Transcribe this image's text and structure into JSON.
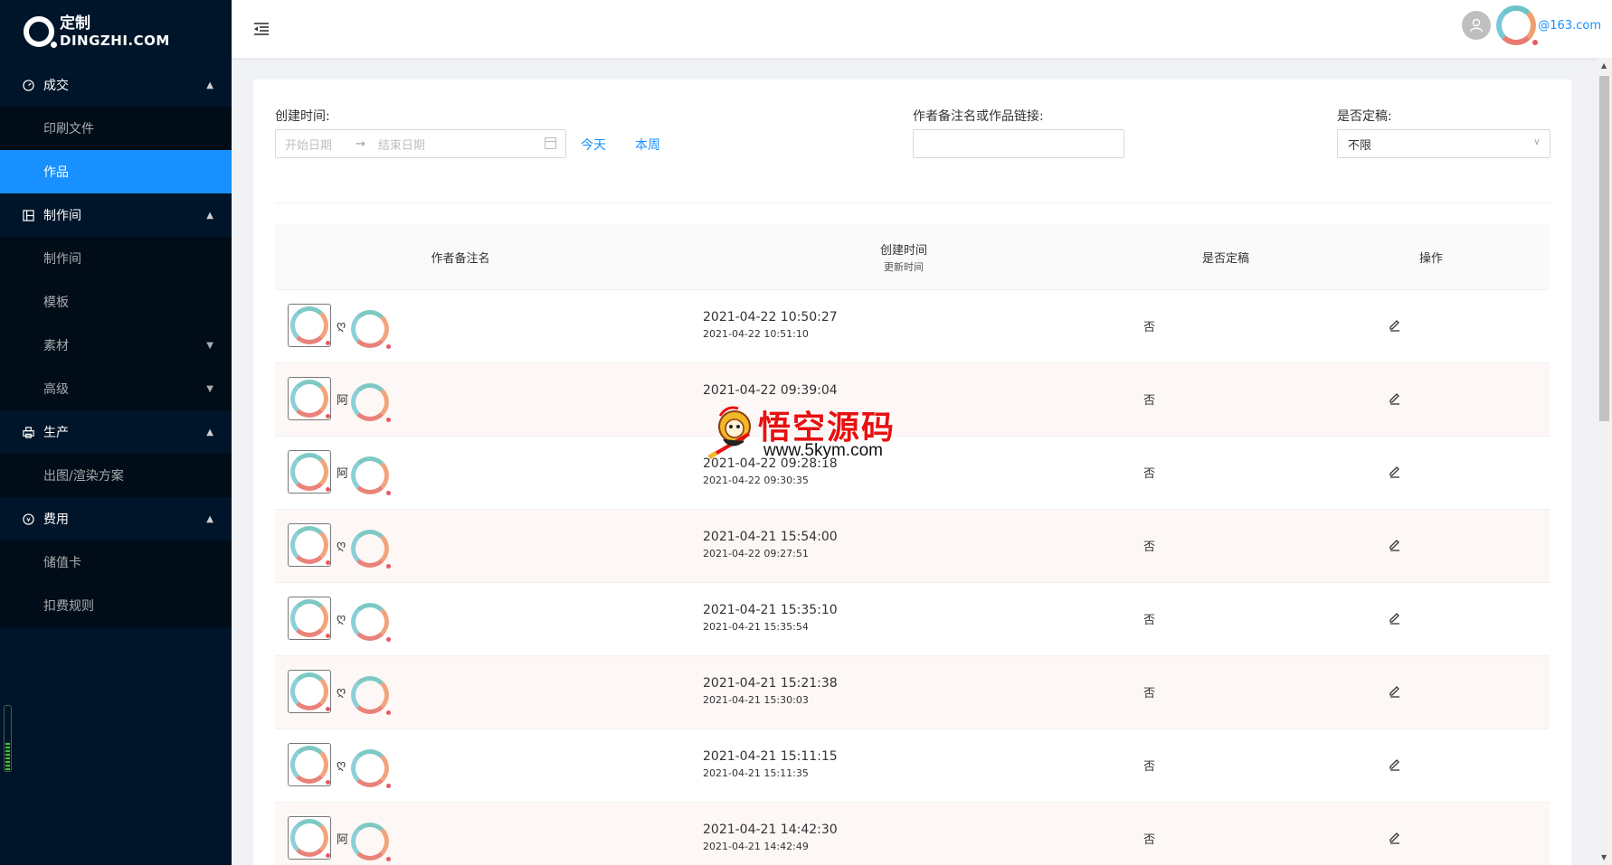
{
  "app": {
    "logo_top": "定制",
    "logo_bottom": "DINGZHI.COM"
  },
  "sidebar": {
    "groups": [
      {
        "title": "成交",
        "icon": "dashboard-icon",
        "items": [
          {
            "label": "印刷文件"
          },
          {
            "label": "作品",
            "active": true
          }
        ]
      },
      {
        "title": "制作间",
        "icon": "layout-icon",
        "items": [
          {
            "label": "制作间"
          },
          {
            "label": "模板"
          },
          {
            "label": "素材"
          },
          {
            "label": "高级"
          }
        ]
      },
      {
        "title": "生产",
        "icon": "printer-icon",
        "items": [
          {
            "label": "出图/渲染方案"
          }
        ]
      },
      {
        "title": "费用",
        "icon": "money-icon",
        "items": [
          {
            "label": "储值卡"
          },
          {
            "label": "扣费规则"
          }
        ]
      }
    ]
  },
  "header": {
    "email": "@163.com"
  },
  "filters": {
    "created_label": "创建时间:",
    "start_placeholder": "开始日期",
    "range_separator": "→",
    "end_placeholder": "结束日期",
    "today": "今天",
    "this_week": "本周",
    "author_label": "作者备注名或作品链接:",
    "author_value": "",
    "final_label": "是否定稿:",
    "final_value": "不限"
  },
  "table": {
    "columns": {
      "author": "作者备注名",
      "created": "创建时间",
      "updated": "更新时间",
      "final": "是否定稿",
      "ops": "操作"
    },
    "rows": [
      {
        "author": "ღ",
        "created": "2021-04-22 10:50:27",
        "updated": "2021-04-22 10:51:10",
        "final": "否"
      },
      {
        "author": "阿",
        "created": "2021-04-22 09:39:04",
        "updated": "",
        "final": "否"
      },
      {
        "author": "阿",
        "created": "2021-04-22 09:28:18",
        "updated": "2021-04-22 09:30:35",
        "final": "否"
      },
      {
        "author": "ღ",
        "created": "2021-04-21 15:54:00",
        "updated": "2021-04-22 09:27:51",
        "final": "否"
      },
      {
        "author": "ღ",
        "created": "2021-04-21 15:35:10",
        "updated": "2021-04-21 15:35:54",
        "final": "否"
      },
      {
        "author": "ღ",
        "created": "2021-04-21 15:21:38",
        "updated": "2021-04-21 15:30:03",
        "final": "否"
      },
      {
        "author": "ღ",
        "created": "2021-04-21 15:11:15",
        "updated": "2021-04-21 15:11:35",
        "final": "否"
      },
      {
        "author": "阿",
        "created": "2021-04-21 14:42:30",
        "updated": "2021-04-21 14:42:49",
        "final": "否"
      }
    ]
  },
  "watermark": {
    "title": "悟空源码",
    "url": "www.5kym.com"
  }
}
